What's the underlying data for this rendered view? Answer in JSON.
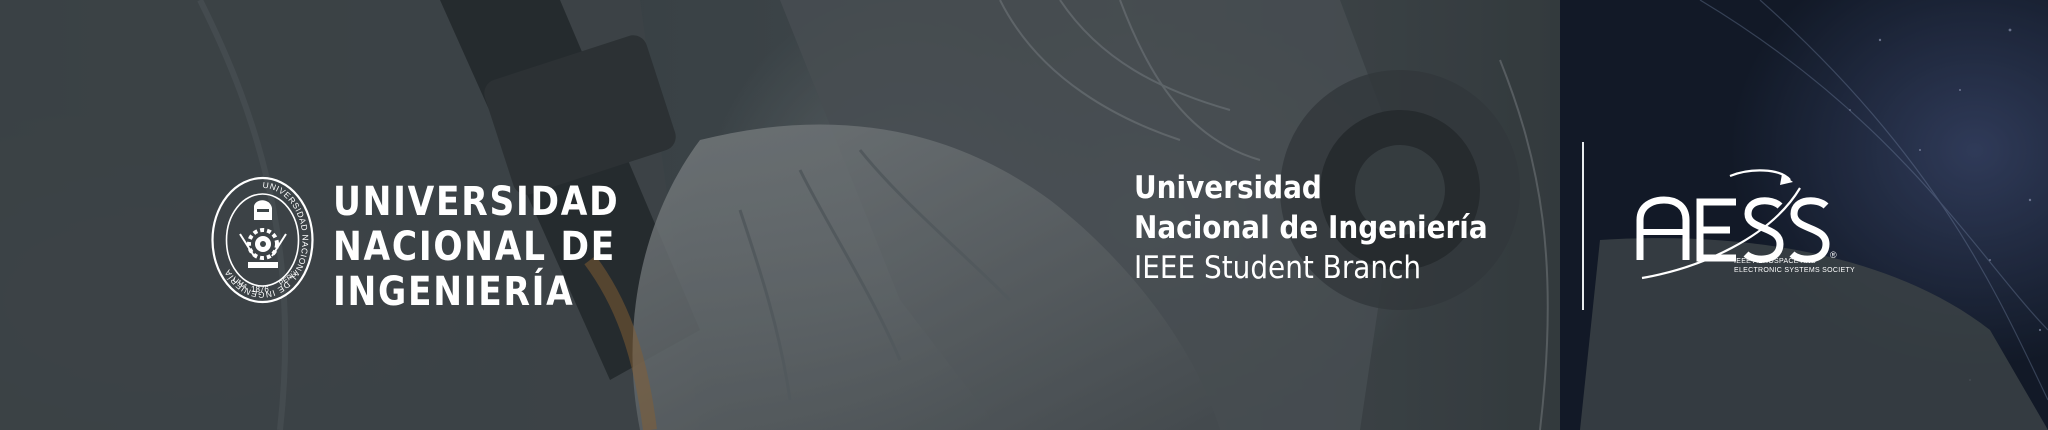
{
  "university": {
    "name_lines": [
      "UNIVERSIDAD",
      "NACIONAL DE",
      "INGENIERÍA"
    ],
    "seal": {
      "ring_text": "UNIVERSIDAD NACIONAL DE INGENIERÍA",
      "bottom_left": "LIMA",
      "bottom_right": "PERÚ",
      "year": "1876"
    }
  },
  "student_branch": {
    "line1": "Universidad",
    "line2": "Nacional de Ingeniería",
    "line3": "IEEE Student Branch"
  },
  "society": {
    "acronym": "AESS",
    "full_name_line1": "IEEE AEROSPACE AND",
    "full_name_line2": "ELECTRONIC SYSTEMS SOCIETY",
    "registered_mark": "®"
  },
  "colors": {
    "text": "#ffffff",
    "background_dark": "#2a3134",
    "space_blue": "#1b2640"
  }
}
